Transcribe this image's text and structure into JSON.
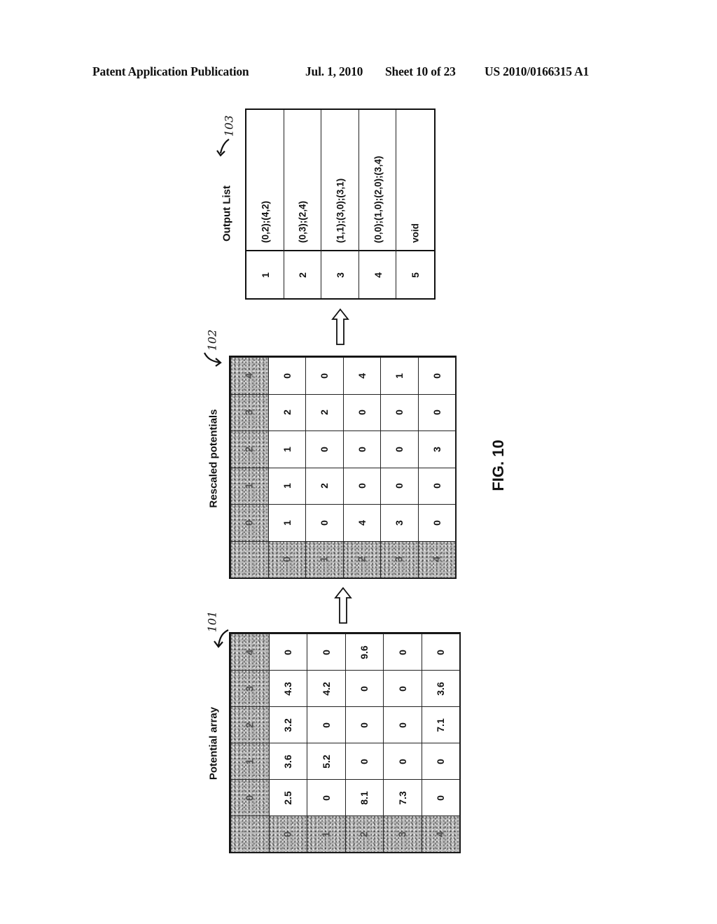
{
  "header": {
    "publication": "Patent Application Publication",
    "date": "Jul. 1, 2010",
    "sheet": "Sheet 10 of 23",
    "number": "US 2010/0166315 A1"
  },
  "figure_label": "FIG. 10",
  "potential_array": {
    "title": "Potential array",
    "ref": "101",
    "col_headers": [
      "0",
      "1",
      "2",
      "3",
      "4"
    ],
    "row_headers": [
      "0",
      "1",
      "2",
      "3",
      "4"
    ],
    "rows": [
      [
        "2.5",
        "3.6",
        "3.2",
        "4.3",
        "0"
      ],
      [
        "0",
        "5.2",
        "0",
        "4.2",
        "0"
      ],
      [
        "8.1",
        "0",
        "0",
        "0",
        "9.6"
      ],
      [
        "7.3",
        "0",
        "0",
        "0",
        "0"
      ],
      [
        "0",
        "0",
        "7.1",
        "3.6",
        "0"
      ]
    ]
  },
  "rescaled_potentials": {
    "title": "Rescaled potentials",
    "ref": "102",
    "col_headers": [
      "0",
      "1",
      "2",
      "3",
      "4"
    ],
    "row_headers": [
      "0",
      "1",
      "2",
      "3",
      "4"
    ],
    "rows": [
      [
        "1",
        "1",
        "1",
        "2",
        "0"
      ],
      [
        "0",
        "2",
        "0",
        "2",
        "0"
      ],
      [
        "4",
        "0",
        "0",
        "0",
        "4"
      ],
      [
        "3",
        "0",
        "0",
        "0",
        "1"
      ],
      [
        "0",
        "0",
        "3",
        "0",
        "0"
      ]
    ]
  },
  "output_list": {
    "title": "Output List",
    "ref": "103",
    "items": [
      {
        "index": "1",
        "value": "(0,2);(4,2)"
      },
      {
        "index": "2",
        "value": "(0,3);(2,4)"
      },
      {
        "index": "3",
        "value": "(1,1);(3,0);(3,1)"
      },
      {
        "index": "4",
        "value": "(0,0);(1,0);(2,0);(3,4)"
      },
      {
        "index": "5",
        "value": "void"
      }
    ]
  },
  "arrows": [
    "up-arrow",
    "up-arrow"
  ]
}
